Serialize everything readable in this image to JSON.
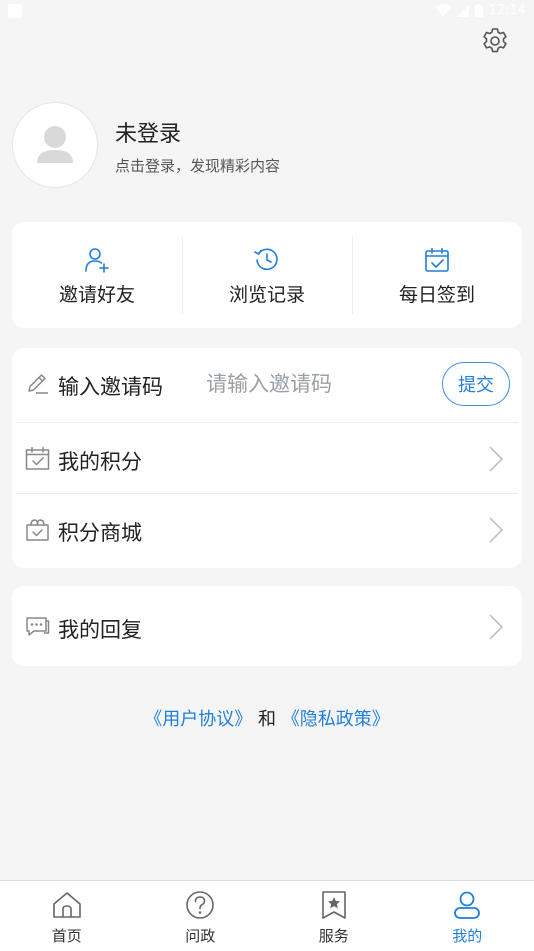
{
  "statusbar": {
    "time": "12:14"
  },
  "profile": {
    "title": "未登录",
    "subtitle": "点击登录，发现精彩内容"
  },
  "quick_actions": [
    {
      "label": "邀请好友",
      "icon": "add-user-icon"
    },
    {
      "label": "浏览记录",
      "icon": "history-icon"
    },
    {
      "label": "每日签到",
      "icon": "calendar-check-icon"
    }
  ],
  "invite": {
    "label": "输入邀请码",
    "placeholder": "请输入邀请码",
    "submit": "提交"
  },
  "menu": {
    "points": "我的积分",
    "mall": "积分商城",
    "replies": "我的回复"
  },
  "links": {
    "user_agreement": "《用户协议》",
    "and": "和",
    "privacy_policy": "《隐私政策》"
  },
  "tabs": [
    {
      "label": "首页",
      "icon": "home-icon"
    },
    {
      "label": "问政",
      "icon": "question-icon"
    },
    {
      "label": "服务",
      "icon": "bookmark-star-icon"
    },
    {
      "label": "我的",
      "icon": "user-icon",
      "active": true
    }
  ],
  "colors": {
    "accent": "#1f7fdb",
    "background": "#f5f5f5",
    "card": "#ffffff"
  }
}
